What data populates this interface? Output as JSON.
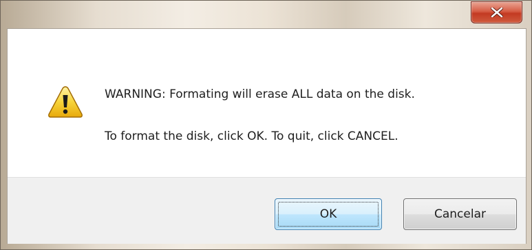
{
  "titlebar": {
    "close_icon": "close-x-icon"
  },
  "message": {
    "icon": "warning-icon",
    "line1": "WARNING: Formating will erase ALL data on the disk.",
    "line2": "To format the disk, click OK. To quit, click CANCEL."
  },
  "buttons": {
    "ok_label": "OK",
    "cancel_label": "Cancelar"
  },
  "colors": {
    "close_button": "#c33a22",
    "ok_button_border": "#3c7fb1",
    "button_bar_bg": "#f0f0f0"
  }
}
